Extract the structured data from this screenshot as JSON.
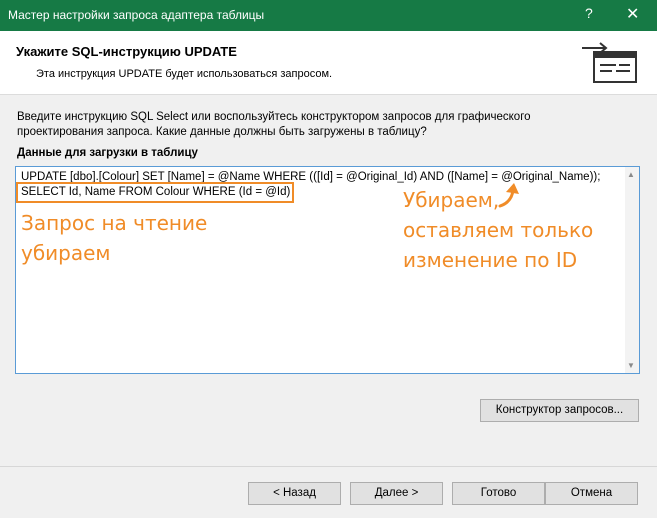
{
  "window": {
    "title": "Мастер настройки запроса адаптера таблицы",
    "help_glyph": "?",
    "close_glyph": "✕"
  },
  "header": {
    "title": "Укажите SQL-инструкцию UPDATE",
    "subtitle": "Эта инструкция UPDATE будет использоваться запросом.",
    "icon": "wizard-sql-icon"
  },
  "intro": {
    "text": "Введите инструкцию SQL Select или воспользуйтесь конструктором запросов для графического проектирования запроса. Какие данные должны быть загружены в таблицу?"
  },
  "data_section": {
    "label": "Данные для загрузки в таблицу",
    "sql_line1": "UPDATE [dbo].[Colour] SET [Name] = @Name WHERE (([Id] = @Original_Id) AND ([Name] = @Original_Name));",
    "sql_line2": "SELECT Id, Name FROM Colour WHERE (Id = @Id)"
  },
  "annotations": {
    "left_line1": "Запрос на чтение",
    "left_line2": "убираем",
    "right_line1": "Убираем,",
    "right_line2": "оставляем только",
    "right_line3": "изменение по ID",
    "color": "#f08c28"
  },
  "buttons": {
    "query_builder": "Конструктор запросов...",
    "back": "< Назад",
    "next": "Далее >",
    "finish": "Готово",
    "cancel": "Отмена"
  },
  "colors": {
    "titlebar": "#167a45",
    "textbox_border": "#5a9bd6"
  }
}
